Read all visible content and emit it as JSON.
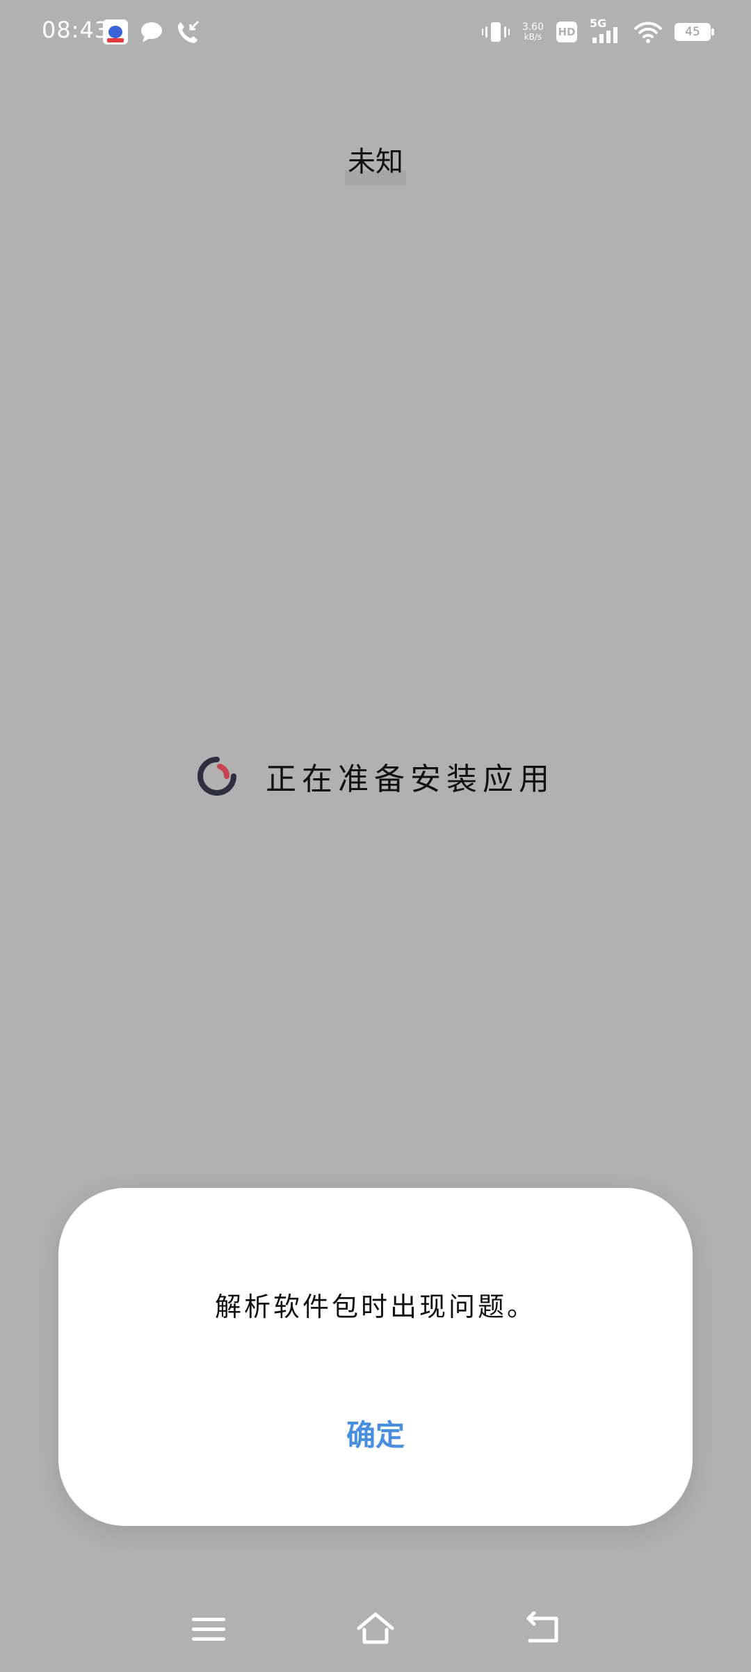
{
  "status_bar": {
    "time": "08:43",
    "net_speed_value": "3.60",
    "net_speed_unit": "kB/s",
    "hd_label": "HD",
    "network_label": "5G",
    "battery_level": "45",
    "icons": [
      "baidu-app-icon",
      "message-icon",
      "missed-call-icon",
      "vibrate-icon",
      "wifi-icon",
      "battery-icon"
    ]
  },
  "installer": {
    "app_name": "未知",
    "status_text": "正在准备安装应用"
  },
  "dialog": {
    "message": "解析软件包时出现问题。",
    "confirm_label": "确定"
  },
  "nav_bar": {
    "icons": [
      "menu-icon",
      "home-icon",
      "back-icon"
    ]
  },
  "colors": {
    "background": "#b1b1b1",
    "dialog_background": "#ffffff",
    "accent": "#4a8ee0",
    "spinner_dark": "#2e2e3e",
    "spinner_red": "#c94452"
  }
}
